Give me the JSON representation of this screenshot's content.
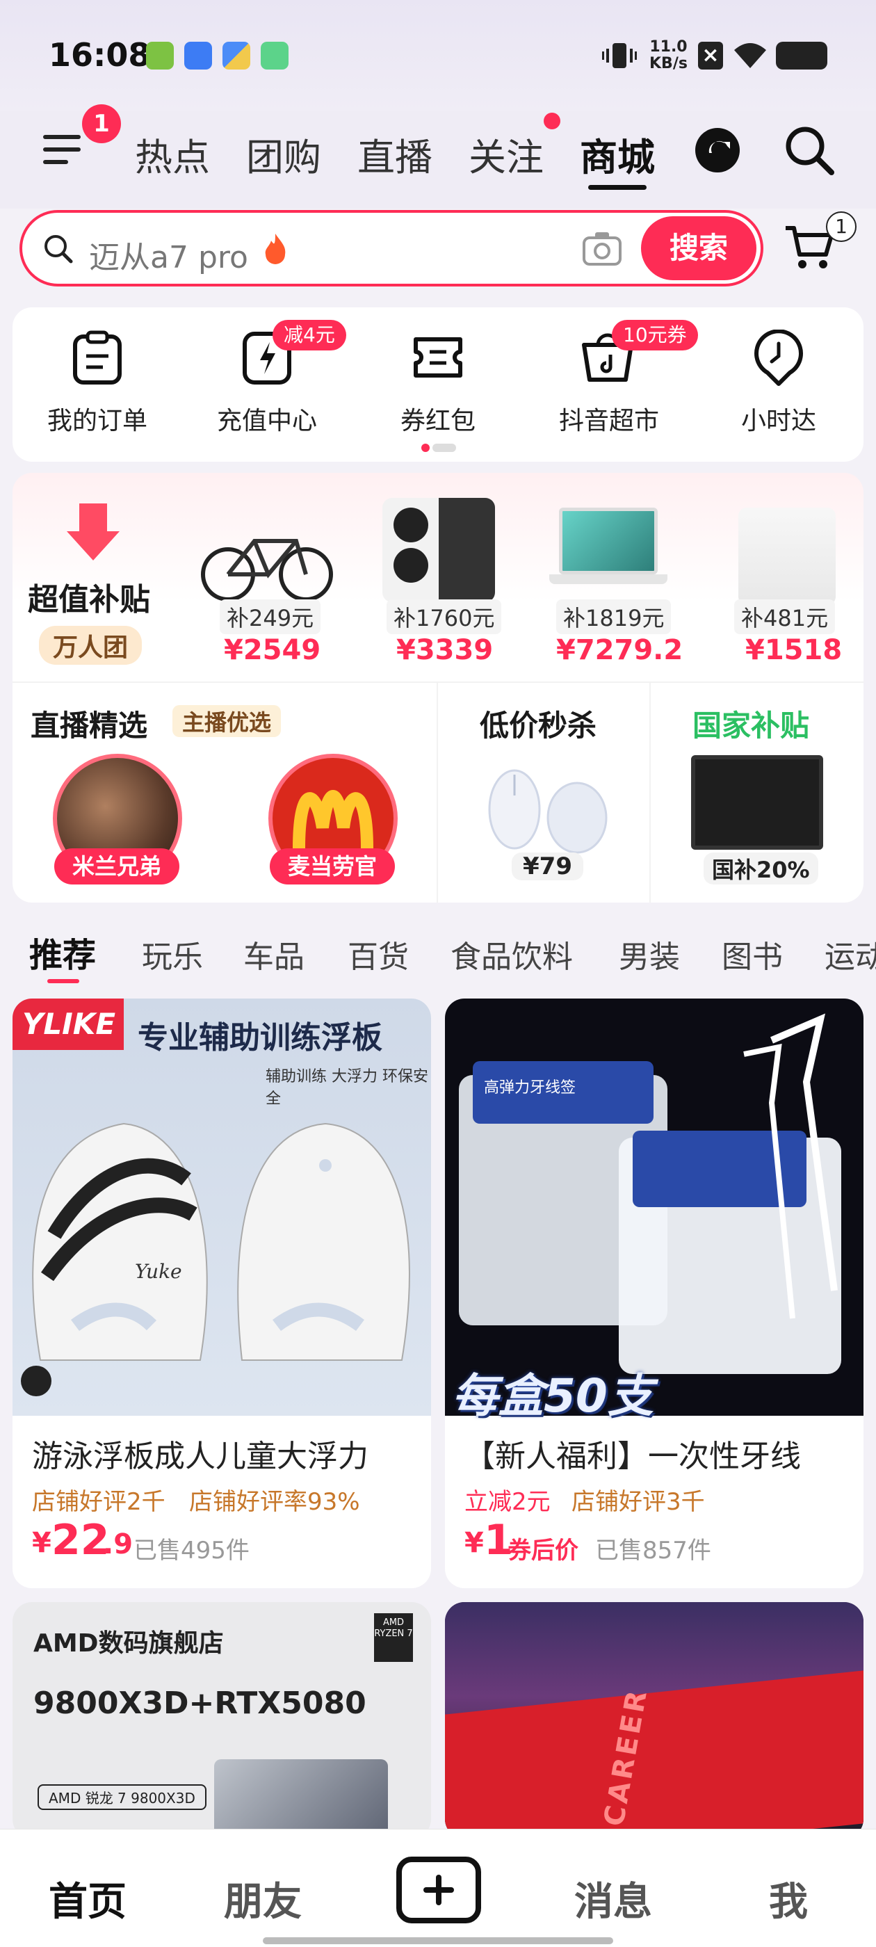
{
  "status_bar": {
    "time": "16:08",
    "net_speed_value": "11.0",
    "net_speed_unit": "KB/s"
  },
  "header": {
    "menu_badge": "1",
    "tabs": [
      {
        "label": "热点",
        "active": false
      },
      {
        "label": "团购",
        "active": false
      },
      {
        "label": "直播",
        "active": false
      },
      {
        "label": "关注",
        "active": false,
        "dot": true
      },
      {
        "label": "商城",
        "active": true
      }
    ]
  },
  "search": {
    "placeholder": "迈从a7 pro",
    "button_label": "搜索",
    "cart_badge": "1"
  },
  "quick_menu": [
    {
      "label": "我的订单",
      "icon": "order-icon"
    },
    {
      "label": "充值中心",
      "icon": "recharge-icon",
      "badge": "减4元"
    },
    {
      "label": "券红包",
      "icon": "coupon-icon"
    },
    {
      "label": "抖音超市",
      "icon": "supermarket-icon",
      "badge": "10元券"
    },
    {
      "label": "小时达",
      "icon": "clock-location-icon"
    }
  ],
  "subsidy": {
    "title": "超值补贴",
    "tag": "万人团",
    "items": [
      {
        "subsidy": "补249元",
        "price": "¥2549",
        "image": "road-bike"
      },
      {
        "subsidy": "补1760元",
        "price": "¥3339",
        "image": "smartphone"
      },
      {
        "subsidy": "补1819元",
        "price": "¥7279.2",
        "image": "laptop"
      },
      {
        "subsidy": "补481元",
        "price": "¥1518",
        "image": "robot-vacuum-station"
      }
    ]
  },
  "live_select": {
    "title": "直播精选",
    "tag": "主播优选",
    "hosts": [
      {
        "name": "米兰兄弟"
      },
      {
        "name": "麦当劳官"
      }
    ]
  },
  "flash_sale": {
    "title": "低价秒杀",
    "price": "¥79"
  },
  "national_subsidy": {
    "title": "国家补贴",
    "tag": "国补20%"
  },
  "categories": [
    "推荐",
    "玩乐",
    "车品",
    "百货",
    "食品饮料",
    "男装",
    "图书",
    "运动"
  ],
  "products": [
    {
      "title": "游泳浮板成人儿童大浮力",
      "meta": [
        "店铺好评2千",
        "店铺好评率93%"
      ],
      "price_currency": "¥",
      "price_int": "22",
      "price_dec": ".9",
      "sold": "已售495件",
      "image_brand": "YLIKE",
      "image_headline": "专业辅助训练浮板",
      "image_sub": "辅助训练 大浮力 环保安全",
      "image_logo": "Yuke"
    },
    {
      "title": "【新人福利】一次性牙线",
      "meta": [
        "立减2元",
        "店铺好评3千"
      ],
      "price_currency": "¥",
      "price_int": "1",
      "price_note": "券后价",
      "sold": "已售857件",
      "image_headline": "每盒50支",
      "image_box_label": "高弹力牙线签"
    },
    {
      "image_store": "AMD数码旗舰店",
      "image_headline": "9800X3D+RTX5080",
      "image_chip": "AMD 锐龙 7 9800X3D",
      "image_brand_box": "AMD RYZEN 7"
    },
    {
      "image_brand": "CAREER"
    }
  ],
  "bottom_nav": [
    {
      "label": "首页",
      "active": true
    },
    {
      "label": "朋友",
      "active": false
    },
    {
      "label": "",
      "icon": "plus-icon"
    },
    {
      "label": "消息",
      "active": false
    },
    {
      "label": "我",
      "active": false
    }
  ],
  "colors": {
    "accent": "#fe2c55",
    "national_green": "#2bbf62",
    "meta_orange": "#c7772a"
  }
}
